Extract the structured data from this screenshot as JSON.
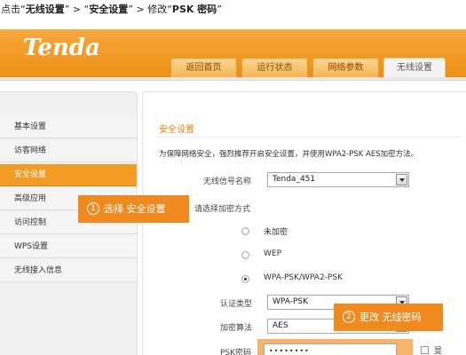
{
  "caption": {
    "prefix": "点击“",
    "step1": "无线设置",
    "mid1": "” > “",
    "step2": "安全设置",
    "mid2": "” > 修改“",
    "step3": "PSK 密码",
    "suffix": "”"
  },
  "brand": {
    "logo_text": "Tenda",
    "accent": "#f29b27"
  },
  "tabs": [
    {
      "label": "返回首页",
      "active": false
    },
    {
      "label": "运行状态",
      "active": false
    },
    {
      "label": "网络参数",
      "active": false
    },
    {
      "label": "无线设置",
      "active": true
    }
  ],
  "sidebar": {
    "items": [
      {
        "label": "基本设置"
      },
      {
        "label": "访客网络"
      },
      {
        "label": "安全设置",
        "active": true
      },
      {
        "label": "高级应用"
      },
      {
        "label": "访问控制"
      },
      {
        "label": "WPS设置"
      },
      {
        "label": "无线接入信息"
      }
    ]
  },
  "main": {
    "section_title": "安全设置",
    "description": "为保障网络安全，强烈推荐开启安全设置，并使用WPA2-PSK AES加密方法。",
    "ssid_label": "无线信号名称",
    "ssid_value": "Tenda_451",
    "encryption_label": "请选择加密方式",
    "encryption_options": [
      {
        "label": "未加密",
        "checked": false
      },
      {
        "label": "WEP",
        "checked": false
      },
      {
        "label": "WPA-PSK/WPA2-PSK",
        "checked": true
      }
    ],
    "auth_label": "认证类型",
    "auth_value": "WPA-PSK",
    "algo_label": "加密算法",
    "algo_value": "AES",
    "psk_label": "PSK密码",
    "psk_value": "••••••••",
    "show_label": "显"
  },
  "callouts": {
    "step1": {
      "num": "1",
      "text": "选择 安全设置"
    },
    "step2": {
      "num": "2",
      "text": "更改 无线密码"
    }
  }
}
